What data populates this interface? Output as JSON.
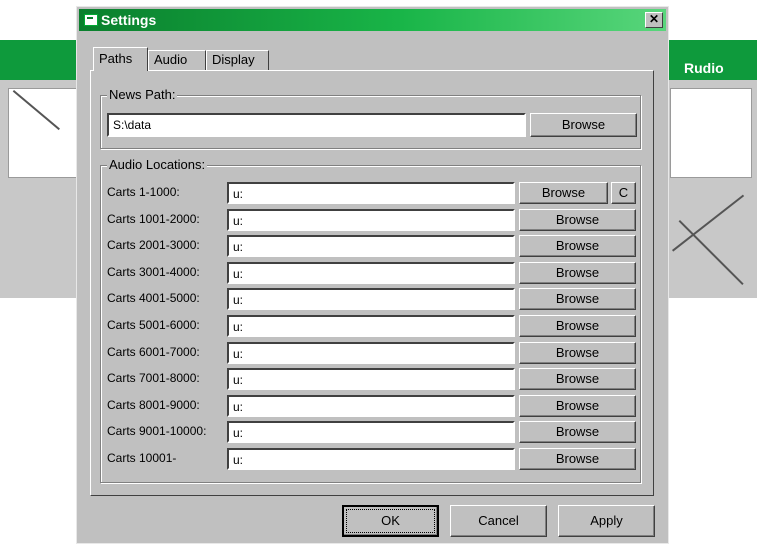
{
  "background_window": {
    "title_fragment": "Rudio"
  },
  "dialog": {
    "title": "Settings",
    "close_glyph": "✕",
    "tabs": [
      "Paths",
      "Audio",
      "Display"
    ],
    "news_path": {
      "legend": "News Path:",
      "value": "S:\\data",
      "browse": "Browse"
    },
    "audio_locations": {
      "legend": "Audio Locations:",
      "browse": "Browse",
      "clear": "C",
      "rows": [
        {
          "label": "Carts 1-1000:",
          "value": "u:"
        },
        {
          "label": "Carts 1001-2000:",
          "value": "u:"
        },
        {
          "label": "Carts 2001-3000:",
          "value": "u:"
        },
        {
          "label": "Carts 3001-4000:",
          "value": "u:"
        },
        {
          "label": "Carts 4001-5000:",
          "value": "u:"
        },
        {
          "label": "Carts 5001-6000:",
          "value": "u:"
        },
        {
          "label": "Carts 6001-7000:",
          "value": "u:"
        },
        {
          "label": "Carts 7001-8000:",
          "value": "u:"
        },
        {
          "label": "Carts 8001-9000:",
          "value": "u:"
        },
        {
          "label": "Carts 9001-10000:",
          "value": "u:"
        },
        {
          "label": "Carts 10001-",
          "value": "u:"
        }
      ]
    },
    "buttons": {
      "ok": "OK",
      "cancel": "Cancel",
      "apply": "Apply"
    }
  }
}
